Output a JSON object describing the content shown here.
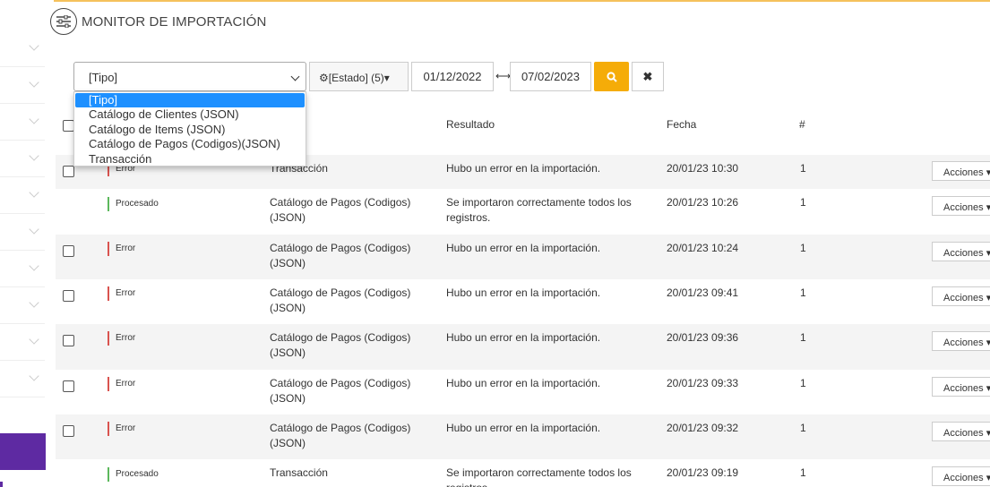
{
  "header": {
    "title": "MONITOR DE IMPORTACIÓN",
    "icon": "sliders-icon"
  },
  "filters": {
    "tipo_value": "[Tipo]",
    "estado_label": "[Estado] (5)",
    "date_from": "01/12/2022",
    "date_sep": "⟷",
    "date_to": "07/02/2023",
    "clear_label": "✖"
  },
  "tipo_options": [
    "[Tipo]",
    "Catálogo de Clientes (JSON)",
    "Catálogo de Items (JSON)",
    "Catálogo de Pagos (Codigos)(JSON)",
    "Transacción"
  ],
  "columns": {
    "resultado": "Resultado",
    "fecha": "Fecha",
    "num": "#"
  },
  "rows": [
    {
      "status": "Error",
      "tipo": "Transacción",
      "resultado": "Hubo un error en la importación.",
      "fecha": "20/01/23 10:30",
      "num": "1",
      "action": "Acciones"
    },
    {
      "status": "Procesado",
      "tipo": "Catálogo de Pagos (Codigos) (JSON)",
      "resultado": "Se importaron correctamente todos los registros.",
      "fecha": "20/01/23 10:26",
      "num": "1",
      "action": "Acciones"
    },
    {
      "status": "Error",
      "tipo": "Catálogo de Pagos (Codigos)(JSON)",
      "resultado": "Hubo un error en la importación.",
      "fecha": "20/01/23 10:24",
      "num": "1",
      "action": "Acciones"
    },
    {
      "status": "Error",
      "tipo": "Catálogo de Pagos (Codigos) (JSON)",
      "resultado": "Hubo un error en la importación.",
      "fecha": "20/01/23 09:41",
      "num": "1",
      "action": "Acciones"
    },
    {
      "status": "Error",
      "tipo": "Catálogo de Pagos (Codigos)(JSON)",
      "resultado": "Hubo un error en la importación.",
      "fecha": "20/01/23 09:36",
      "num": "1",
      "action": "Acciones"
    },
    {
      "status": "Error",
      "tipo": "Catálogo de Pagos (Codigos) (JSON)",
      "resultado": "Hubo un error en la importación.",
      "fecha": "20/01/23 09:33",
      "num": "1",
      "action": "Acciones"
    },
    {
      "status": "Error",
      "tipo": "Catálogo de Pagos (Codigos)(JSON)",
      "resultado": "Hubo un error en la importación.",
      "fecha": "20/01/23 09:32",
      "num": "1",
      "action": "Acciones"
    },
    {
      "status": "Procesado",
      "tipo": "Transacción",
      "resultado": "Se importaron correctamente todos los registros.",
      "fecha": "20/01/23 09:19",
      "num": "1",
      "action": "Acciones"
    }
  ],
  "colors": {
    "accent": "#f5ac08",
    "error": "#d9534f",
    "ok": "#5cb85c",
    "sidebar": "#5e2aa2",
    "selection": "#1e90ff"
  }
}
